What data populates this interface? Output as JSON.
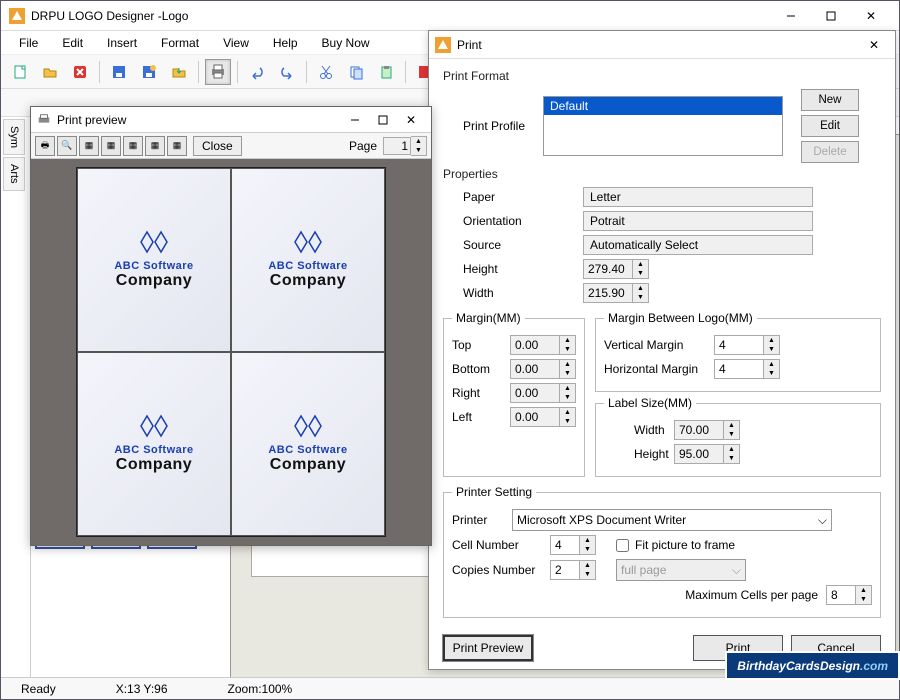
{
  "app": {
    "title": "DRPU LOGO Designer -Logo"
  },
  "menu": {
    "file": "File",
    "edit": "Edit",
    "insert": "Insert",
    "format": "Format",
    "view": "View",
    "help": "Help",
    "buynow": "Buy Now"
  },
  "side": {
    "sym": "Sym",
    "arts": "Arts"
  },
  "status": {
    "ready": "Ready",
    "coords": "X:13  Y:96",
    "zoom": "Zoom:100%"
  },
  "preview": {
    "title": "Print preview",
    "close": "Close",
    "page_label": "Page",
    "page_value": "1",
    "logo_line1": "ABC Software",
    "logo_line2": "Company"
  },
  "print": {
    "title": "Print",
    "format_label": "Print Format",
    "profile_label": "Print Profile",
    "profile_selected": "Default",
    "btn_new": "New",
    "btn_edit": "Edit",
    "btn_delete": "Delete",
    "properties_label": "Properties",
    "paper_label": "Paper",
    "paper_value": "Letter",
    "orientation_label": "Orientation",
    "orientation_value": "Potrait",
    "source_label": "Source",
    "source_value": "Automatically Select",
    "height_label": "Height",
    "height_value": "279.40",
    "width_label": "Width",
    "width_value": "215.90",
    "margin_legend": "Margin(MM)",
    "margin_top_label": "Top",
    "margin_top": "0.00",
    "margin_bottom_label": "Bottom",
    "margin_bottom": "0.00",
    "margin_right_label": "Right",
    "margin_right": "0.00",
    "margin_left_label": "Left",
    "margin_left": "0.00",
    "between_legend": "Margin Between Logo(MM)",
    "vmargin_label": "Vertical Margin",
    "vmargin": "4",
    "hmargin_label": "Horizontal Margin",
    "hmargin": "4",
    "labelsize_legend": "Label Size(MM)",
    "ls_width_label": "Width",
    "ls_width": "70.00",
    "ls_height_label": "Height",
    "ls_height": "95.00",
    "printer_legend": "Printer Setting",
    "printer_label": "Printer",
    "printer_value": "Microsoft XPS Document Writer",
    "cell_label": "Cell Number",
    "cell_value": "4",
    "copies_label": "Copies Number",
    "copies_value": "2",
    "fit_label": "Fit picture to frame",
    "fullpage": "full page",
    "maxcells_label": "Maximum Cells per page",
    "maxcells_value": "8",
    "btn_preview": "Print Preview",
    "btn_print": "Print",
    "btn_cancel": "Cancel"
  },
  "watermark": {
    "a": "BirthdayCardsDesign",
    "b": ".com"
  }
}
